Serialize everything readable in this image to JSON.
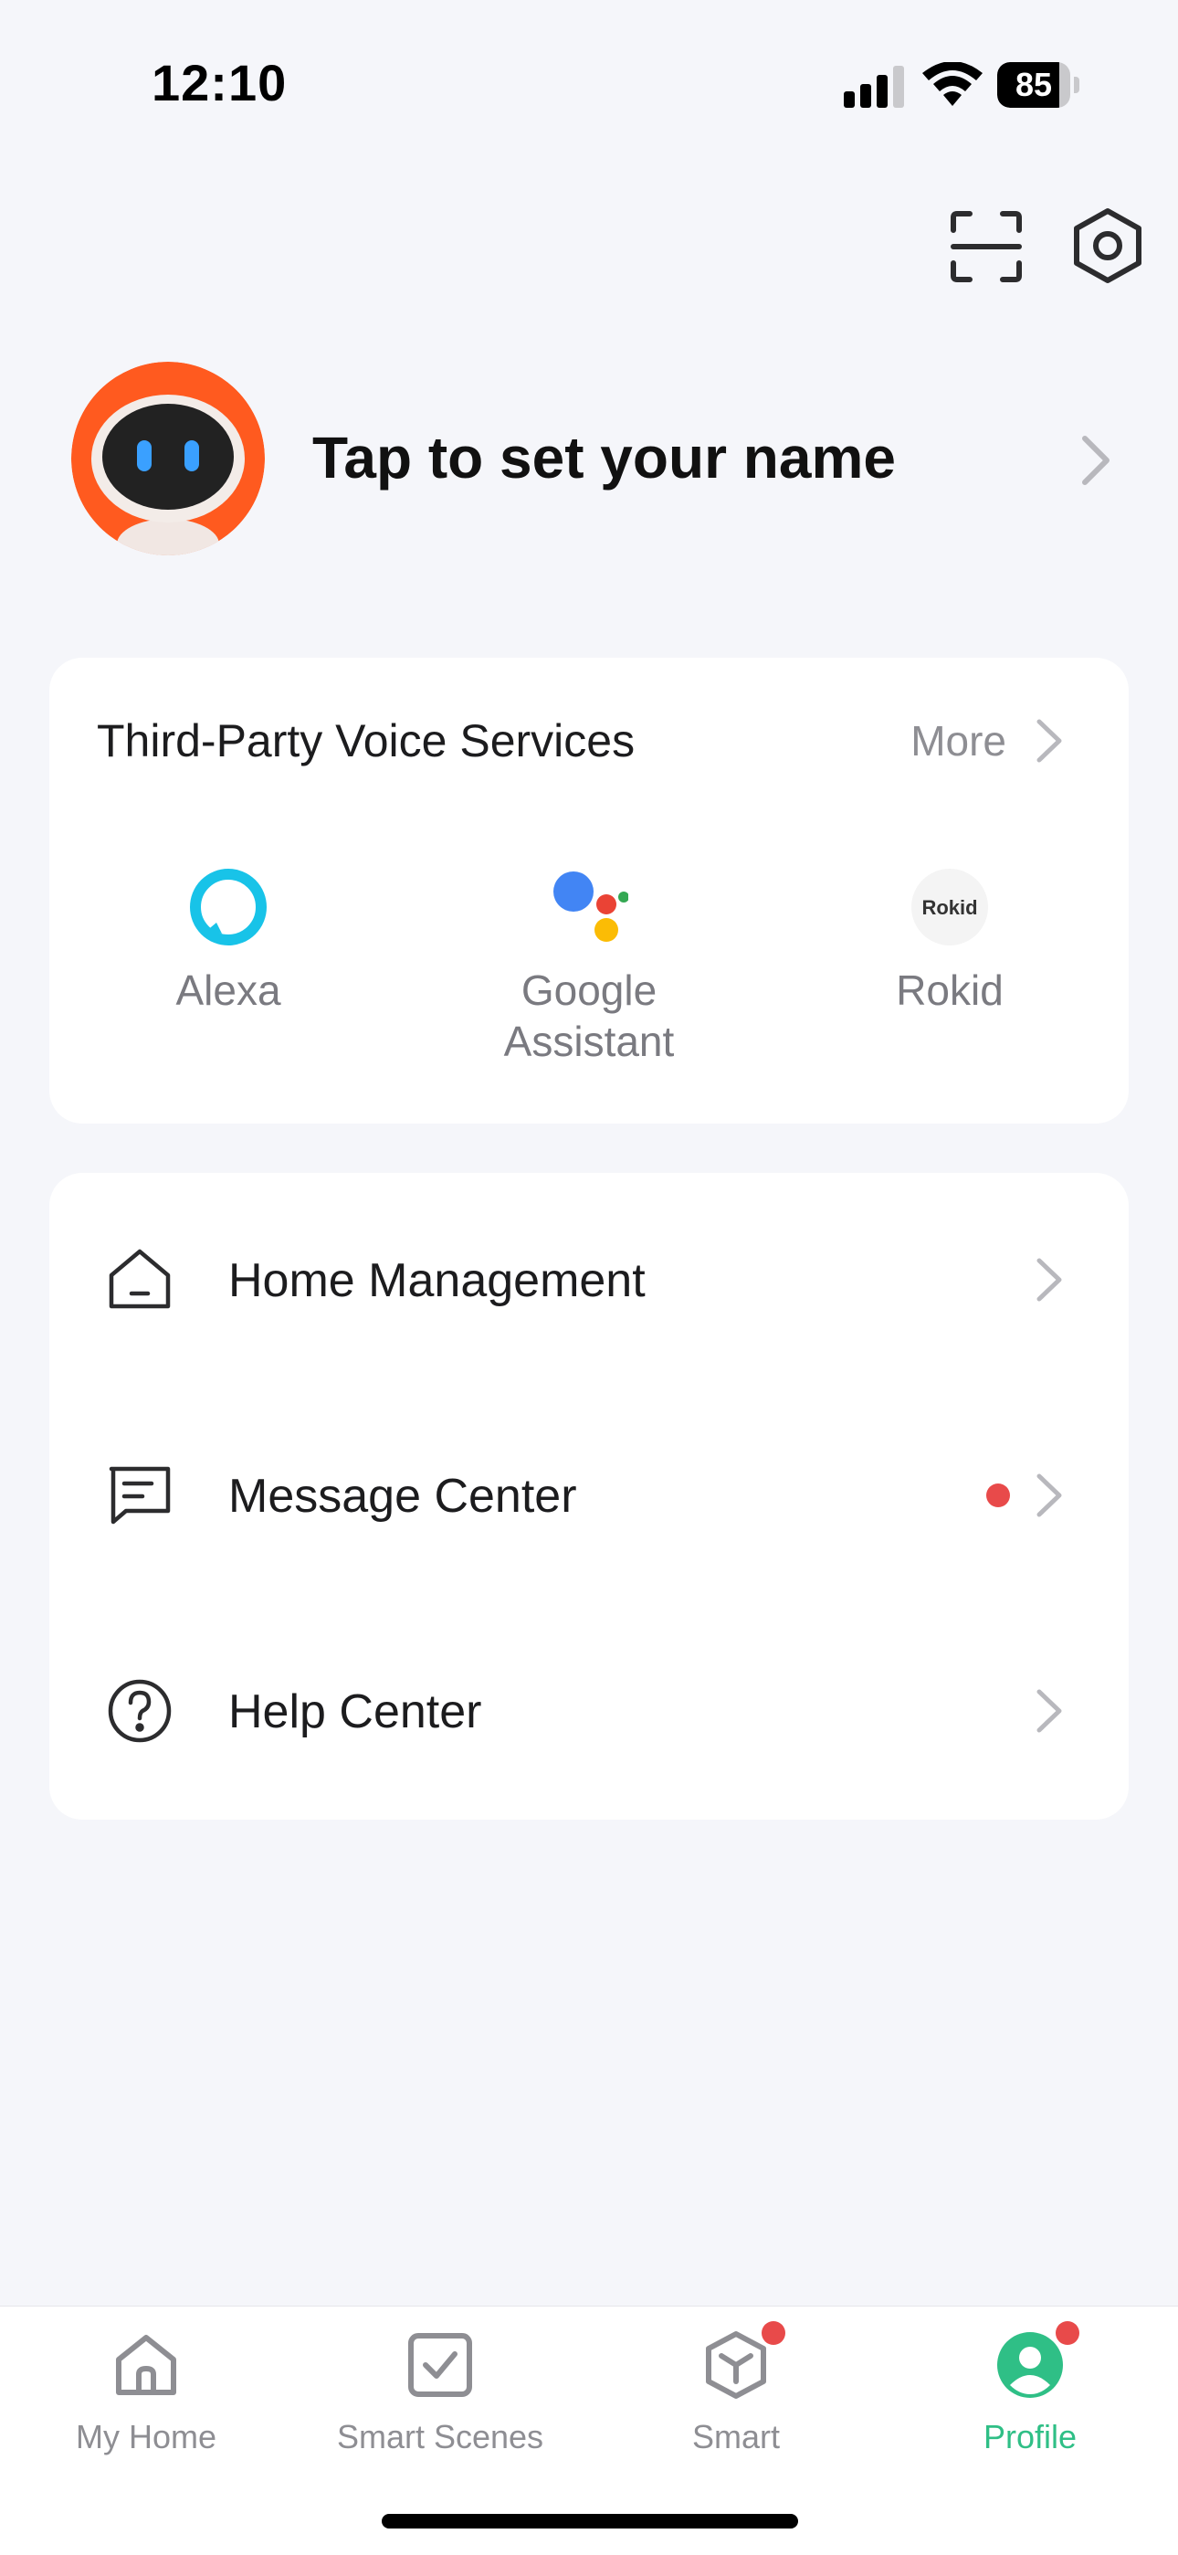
{
  "status_bar": {
    "time": "12:10",
    "battery_percent": "85",
    "signal_bars": 3,
    "wifi": true
  },
  "header": {
    "scan_icon": "scan-icon",
    "settings_icon": "settings-icon"
  },
  "profile": {
    "name_prompt": "Tap to set your name",
    "avatar_icon": "robot-avatar"
  },
  "voice_services": {
    "title": "Third-Party Voice Services",
    "more_label": "More",
    "items": [
      {
        "label": "Alexa",
        "icon": "alexa-icon"
      },
      {
        "label": "Google Assistant",
        "icon": "google-assistant-icon"
      },
      {
        "label": "Rokid",
        "icon": "rokid-icon",
        "logo_text": "Rokid"
      }
    ]
  },
  "menu": {
    "items": [
      {
        "label": "Home Management",
        "icon": "home-icon",
        "badge": false
      },
      {
        "label": "Message Center",
        "icon": "message-icon",
        "badge": true
      },
      {
        "label": "Help Center",
        "icon": "help-icon",
        "badge": false
      }
    ]
  },
  "tabbar": {
    "items": [
      {
        "label": "My Home",
        "icon": "home-tab-icon",
        "active": false,
        "badge": false
      },
      {
        "label": "Smart Scenes",
        "icon": "checkbox-tab-icon",
        "active": false,
        "badge": false
      },
      {
        "label": "Smart",
        "icon": "cube-tab-icon",
        "active": false,
        "badge": true
      },
      {
        "label": "Profile",
        "icon": "profile-tab-icon",
        "active": true,
        "badge": true
      }
    ]
  },
  "colors": {
    "accent": "#2fbf86",
    "badge": "#e84a4a",
    "background": "#f5f6fa",
    "avatar_orange": "#ff5a1f"
  }
}
